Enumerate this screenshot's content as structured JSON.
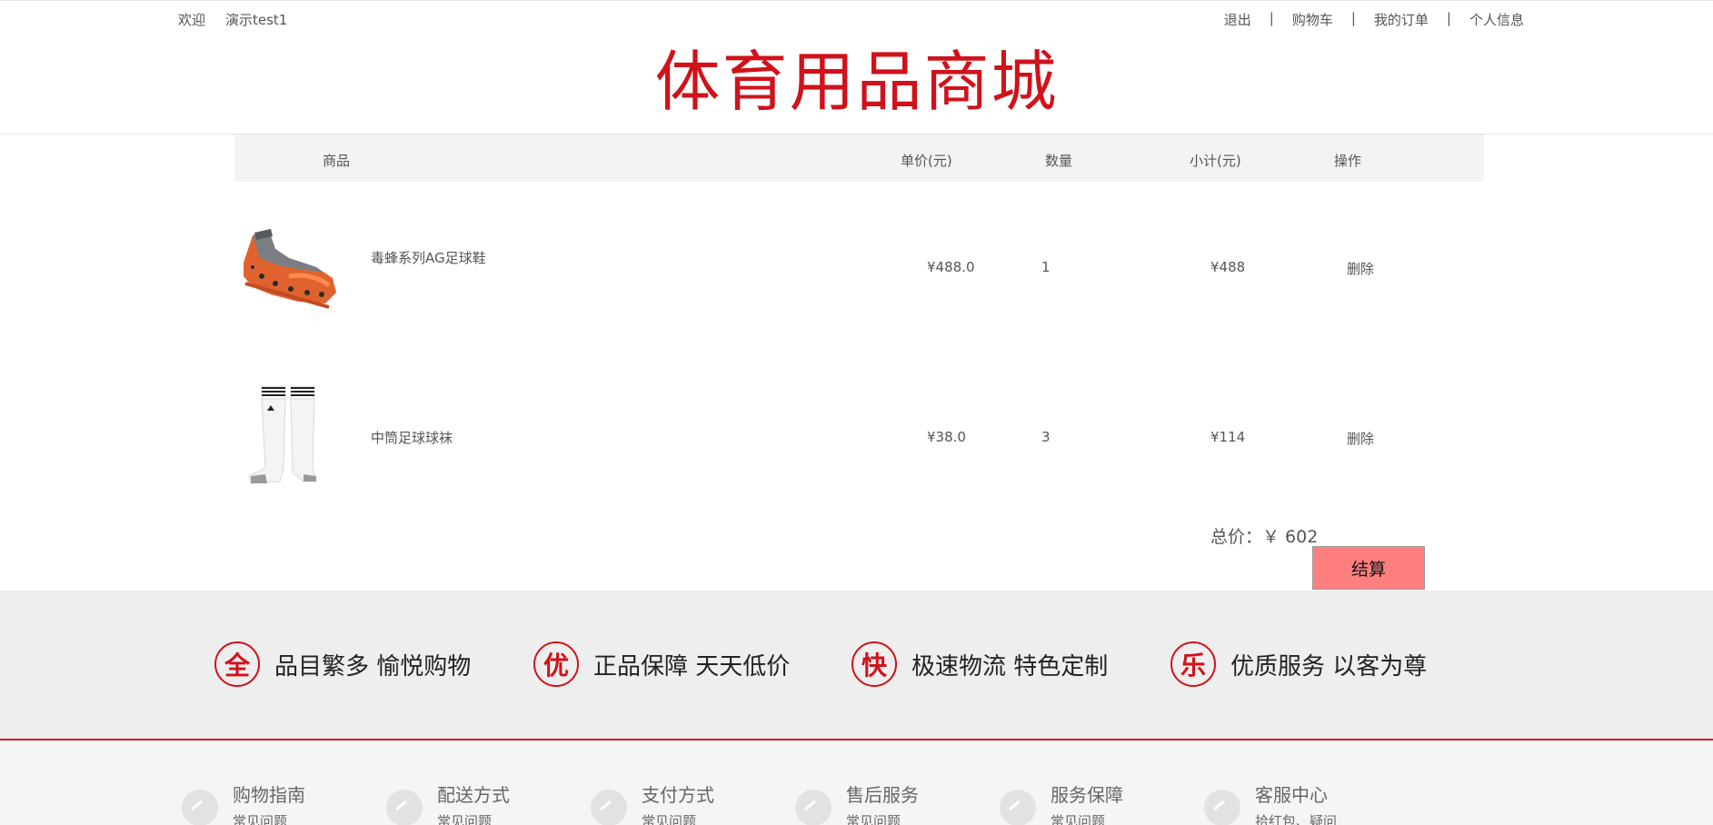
{
  "topbar": {
    "welcome": "欢迎",
    "username": "演示test1",
    "nav": [
      "退出",
      "购物车",
      "我的订单",
      "个人信息"
    ],
    "separator": "|"
  },
  "logo": "体育用品商城",
  "cart_header": {
    "product": "商品",
    "unit_price": "单价(元)",
    "quantity": "数量",
    "subtotal": "小计(元)",
    "action": "操作"
  },
  "cart_items": [
    {
      "name": "毒蜂系列AG足球鞋",
      "price": "¥488.0",
      "qty": "1",
      "subtotal": "¥488",
      "action": "删除",
      "image": "soccer-shoe-icon"
    },
    {
      "name": "中筒足球球袜",
      "price": "¥38.0",
      "qty": "3",
      "subtotal": "¥114",
      "action": "删除",
      "image": "soccer-socks-icon"
    }
  ],
  "total": {
    "label": "总价：￥ 602"
  },
  "checkout_label": "结算",
  "features": [
    {
      "char": "全",
      "text": "品目繁多 愉悦购物"
    },
    {
      "char": "优",
      "text": "正品保障 天天低价"
    },
    {
      "char": "快",
      "text": "极速物流 特色定制"
    },
    {
      "char": "乐",
      "text": "优质服务 以客为尊"
    }
  ],
  "footer": [
    {
      "title": "购物指南",
      "link": "常见问题"
    },
    {
      "title": "配送方式",
      "link": "常见问题"
    },
    {
      "title": "支付方式",
      "link": "常见问题"
    },
    {
      "title": "售后服务",
      "link": "常见问题"
    },
    {
      "title": "服务保障",
      "link": "常见问题"
    },
    {
      "title": "客服中心",
      "link": "拾红包、疑问"
    }
  ],
  "colors": {
    "brand_red": "#d0121b",
    "checkout_bg": "#ff7f7f",
    "features_bg": "#eeeeee"
  }
}
